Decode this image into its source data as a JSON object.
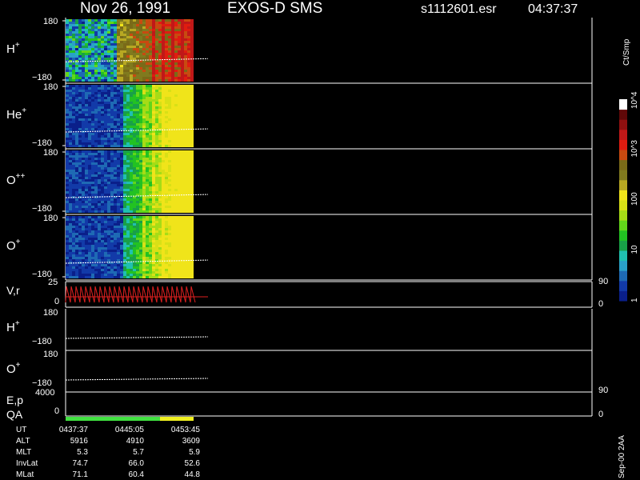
{
  "header": {
    "date": "Nov 26, 1991",
    "instrument": "EXOS-D SMS",
    "file": "s1112601.esr",
    "time": "04:37:37"
  },
  "colorbar": {
    "units": "Ct/Smp",
    "ticks": [
      {
        "value": "1",
        "level": 0
      },
      {
        "value": "10",
        "level": 1
      },
      {
        "value": "100",
        "level": 2
      },
      {
        "value": "10^3",
        "level": 3
      },
      {
        "value": "10^4",
        "level": 4
      }
    ],
    "colors": [
      "#0a1f8a",
      "#123aa8",
      "#1e6ab4",
      "#2aa0c8",
      "#20c0b0",
      "#18a048",
      "#22c222",
      "#62d61a",
      "#a6dc16",
      "#d8e016",
      "#f0e41a",
      "#b8a822",
      "#807a1e",
      "#7a6a18",
      "#c84a10",
      "#e01c10",
      "#c01818",
      "#901010",
      "#600808",
      "#ffffff"
    ]
  },
  "panels": [
    {
      "label": "H",
      "sup": "+",
      "ymax": "180",
      "ymin": "−180",
      "max_color_level": 0.85,
      "trace_level": 0.65
    },
    {
      "label": "He",
      "sup": "+",
      "ymax": "180",
      "ymin": "−180",
      "max_color_level": 0.55,
      "trace_level": 0.72
    },
    {
      "label": "O",
      "sup": "++",
      "ymax": "180",
      "ymin": "−180",
      "max_color_level": 0.55,
      "trace_level": 0.72
    },
    {
      "label": "O",
      "sup": "+",
      "ymax": "180",
      "ymin": "−180",
      "max_color_level": 0.55,
      "trace_level": 0.72
    }
  ],
  "vr_panel": {
    "label": "V,r",
    "left_top": "25",
    "left_bottom": "0",
    "right_top": "90",
    "right_bottom": "0",
    "color": "#e02020"
  },
  "line_panels": [
    {
      "label": "H",
      "sup": "+",
      "ymax": "180",
      "ymin": "−180"
    },
    {
      "label": "O",
      "sup": "+",
      "ymax": "180",
      "ymin": "−180"
    }
  ],
  "ep_panel": {
    "label1": "E,p",
    "label2": "QA",
    "left_top": "4000",
    "left_bottom": "0",
    "right_top": "90",
    "right_bottom": "0",
    "qa_colors": [
      "#40e040",
      "#f0f020"
    ]
  },
  "footer": {
    "rows": [
      {
        "label": "UT",
        "values": [
          "0437:37",
          "0445:05",
          "0453:45"
        ]
      },
      {
        "label": "ALT",
        "values": [
          "5916",
          "4910",
          "3609"
        ]
      },
      {
        "label": "MLT",
        "values": [
          "5.3",
          "5.7",
          "5.9"
        ]
      },
      {
        "label": "InvLat",
        "values": [
          "74.7",
          "66.0",
          "52.6"
        ]
      },
      {
        "label": "MLat",
        "values": [
          "71.1",
          "60.4",
          "44.8"
        ]
      }
    ],
    "note": "Sep-00 2AA"
  }
}
